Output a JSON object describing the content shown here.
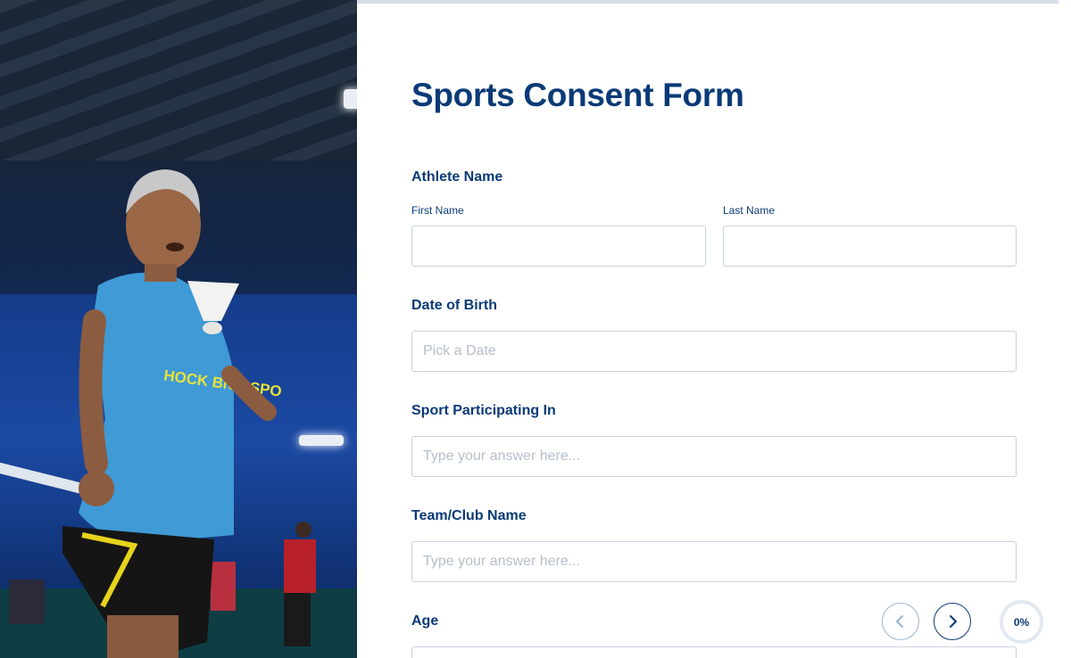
{
  "form": {
    "title": "Sports Consent Form",
    "athlete_name": {
      "label": "Athlete Name",
      "first_name_label": "First Name",
      "last_name_label": "Last Name",
      "first_name_value": "",
      "last_name_value": ""
    },
    "date_of_birth": {
      "label": "Date of Birth",
      "placeholder": "Pick a Date"
    },
    "sport": {
      "label": "Sport Participating In",
      "placeholder": "Type your answer here..."
    },
    "team": {
      "label": "Team/Club Name",
      "placeholder": "Type your answer here..."
    },
    "age": {
      "label": "Age"
    }
  },
  "navigation": {
    "prev_icon": "chevron-left-icon",
    "next_icon": "chevron-right-icon",
    "progress": "0%"
  },
  "colors": {
    "primary": "#0a3a77",
    "border": "#c9d2de",
    "placeholder": "#b5bfcb"
  }
}
